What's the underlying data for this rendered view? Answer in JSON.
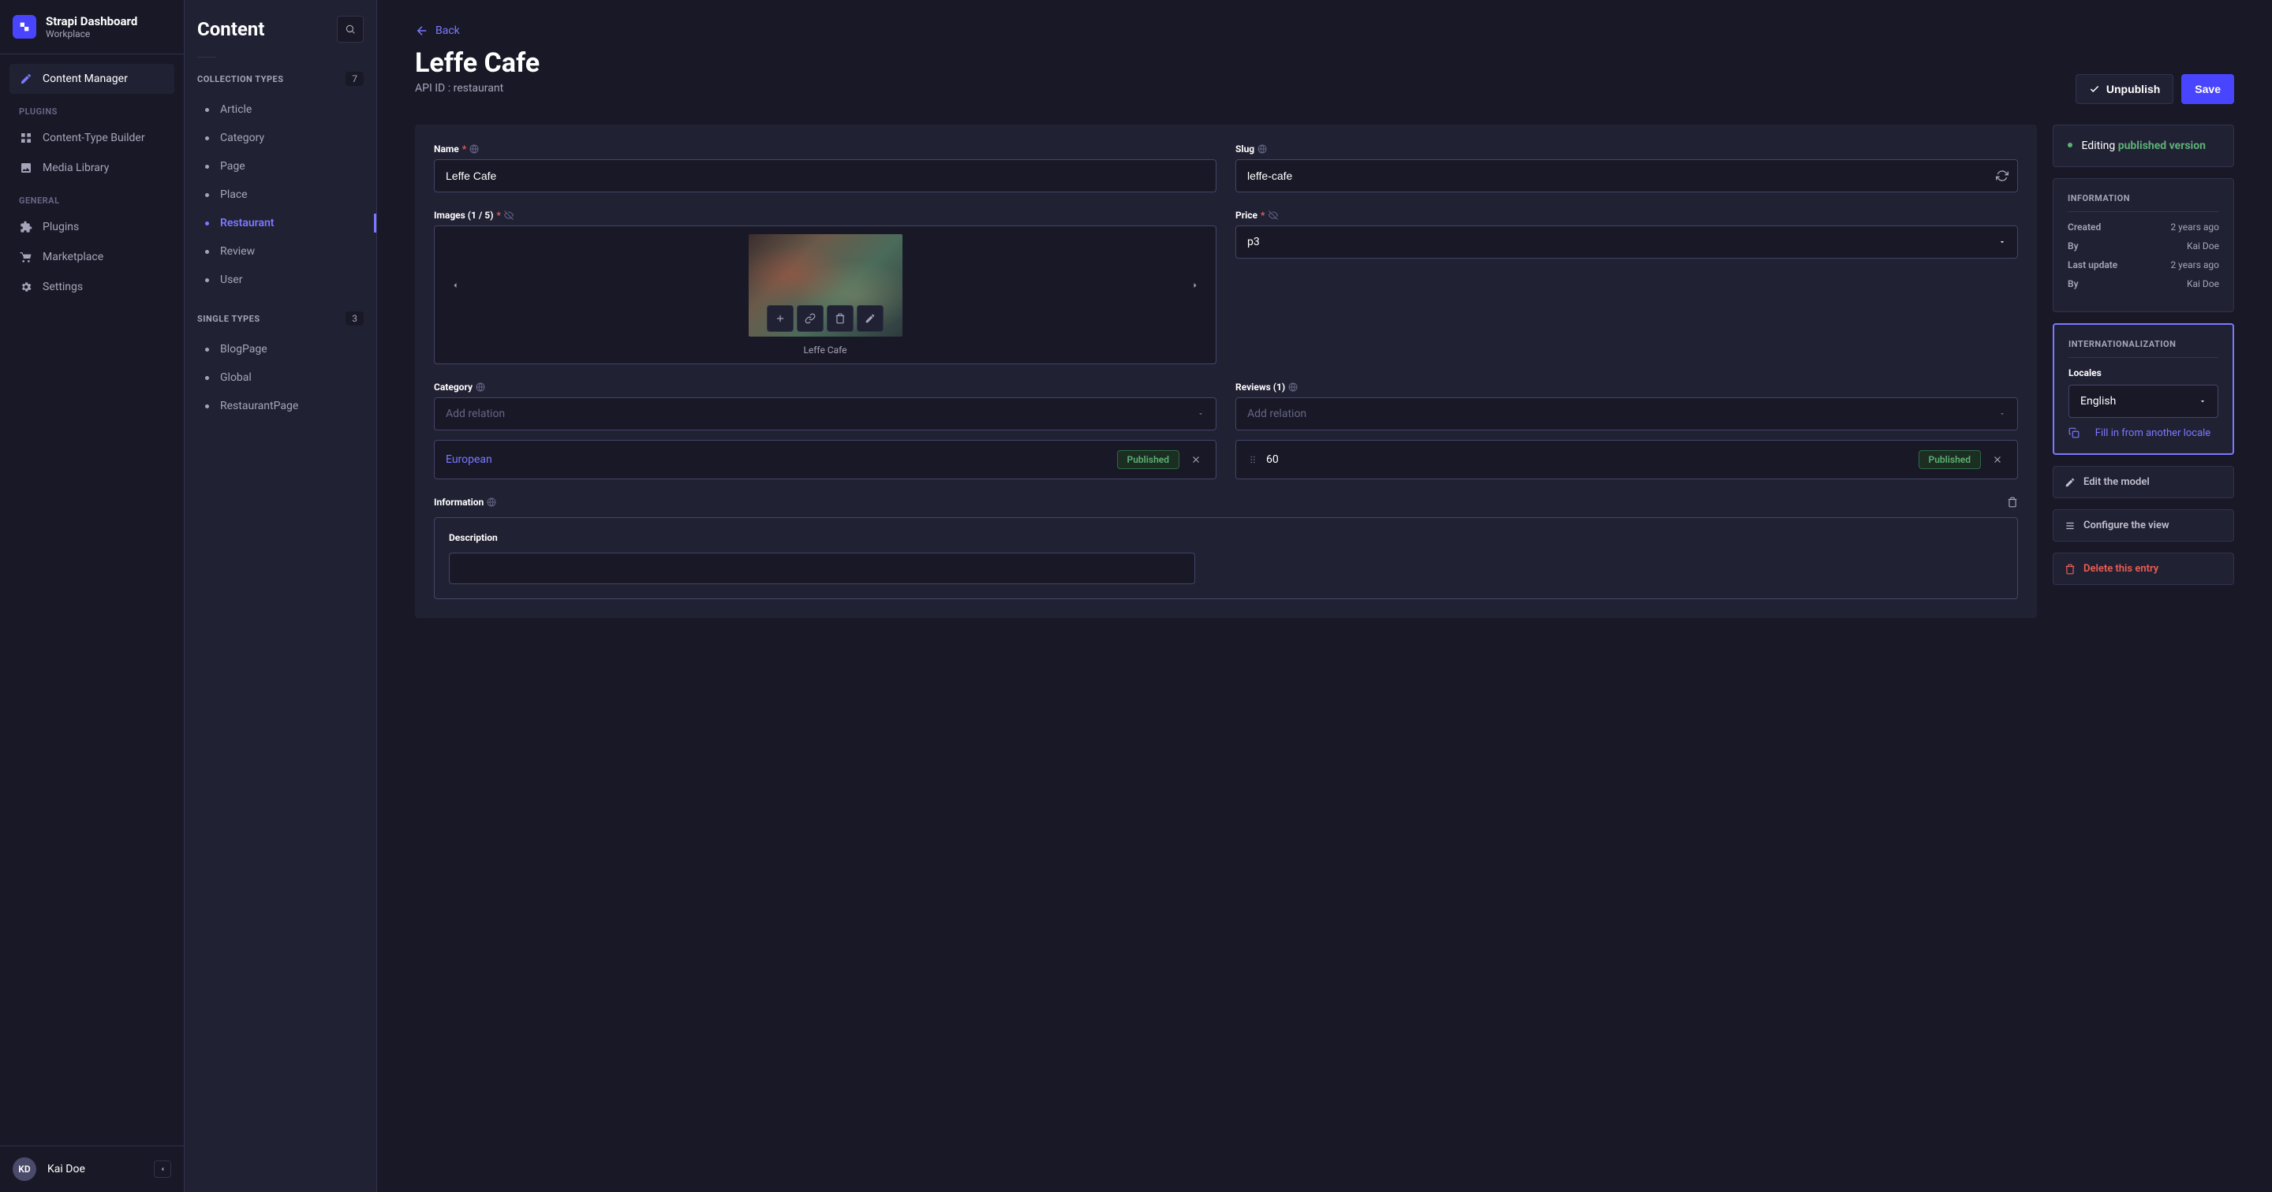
{
  "app": {
    "title": "Strapi Dashboard",
    "subtitle": "Workplace"
  },
  "nav": {
    "contentManager": "Content Manager",
    "plugins": "PLUGINS",
    "general": "GENERAL",
    "items": {
      "ctb": "Content-Type Builder",
      "media": "Media Library",
      "plugins": "Plugins",
      "marketplace": "Marketplace",
      "settings": "Settings"
    }
  },
  "user": {
    "initials": "KD",
    "name": "Kai Doe"
  },
  "contentPanel": {
    "title": "Content",
    "collectionTypes": {
      "label": "COLLECTION TYPES",
      "count": "7"
    },
    "collectionItems": [
      "Article",
      "Category",
      "Page",
      "Place",
      "Restaurant",
      "Review",
      "User"
    ],
    "singleTypes": {
      "label": "SINGLE TYPES",
      "count": "3"
    },
    "singleItems": [
      "BlogPage",
      "Global",
      "RestaurantPage"
    ]
  },
  "page": {
    "back": "Back",
    "title": "Leffe Cafe",
    "apiId": "API ID : restaurant",
    "unpublish": "Unpublish",
    "save": "Save"
  },
  "fields": {
    "name": {
      "label": "Name",
      "value": "Leffe Cafe"
    },
    "slug": {
      "label": "Slug",
      "value": "leffe-cafe"
    },
    "images": {
      "label": "Images (1 / 5)",
      "caption": "Leffe Cafe"
    },
    "price": {
      "label": "Price",
      "value": "p3"
    },
    "category": {
      "label": "Category",
      "placeholder": "Add relation",
      "item": "European",
      "status": "Published"
    },
    "reviews": {
      "label": "Reviews (1)",
      "placeholder": "Add relation",
      "item": "60",
      "status": "Published"
    },
    "information": {
      "label": "Information",
      "description": "Description"
    }
  },
  "status": {
    "editing": "Editing",
    "published": "published version"
  },
  "info": {
    "title": "INFORMATION",
    "created": "Created",
    "createdVal": "2 years ago",
    "by": "By",
    "byVal": "Kai Doe",
    "lastUpdate": "Last update",
    "lastUpdateVal": "2 years ago",
    "by2": "By",
    "byVal2": "Kai Doe"
  },
  "i18n": {
    "title": "INTERNATIONALIZATION",
    "locales": "Locales",
    "value": "English",
    "fill": "Fill in from another locale"
  },
  "actions": {
    "edit": "Edit the model",
    "configure": "Configure the view",
    "delete": "Delete this entry"
  }
}
